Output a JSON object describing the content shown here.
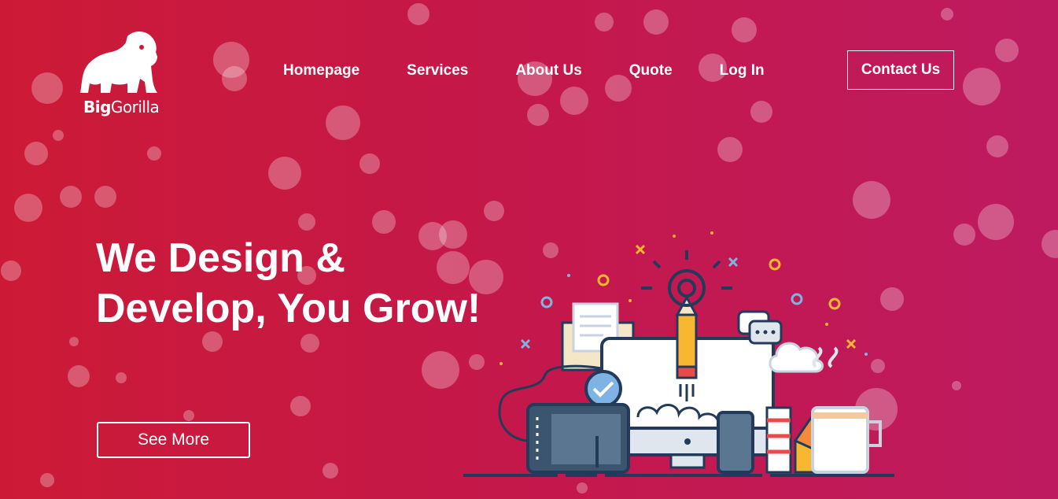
{
  "brand": {
    "name_bold": "Big",
    "name_regular": "Gorilla",
    "logo_icon": "gorilla-icon"
  },
  "nav": {
    "items": [
      {
        "label": "Homepage"
      },
      {
        "label": "Services"
      },
      {
        "label": "About Us"
      },
      {
        "label": "Quote"
      },
      {
        "label": "Log In"
      }
    ],
    "contact_label": "Contact Us"
  },
  "hero": {
    "title_line1": "We Design &",
    "title_line2": "Develop, You Grow!",
    "cta_label": "See More",
    "illustration_icon": "design-workspace-illustration"
  },
  "colors": {
    "gradient_start": "#cc1a36",
    "gradient_end": "#be1a60",
    "text": "#ffffff",
    "navy": "#233a5a",
    "yellow": "#f7b731",
    "light_blue": "#7fb3e3"
  }
}
